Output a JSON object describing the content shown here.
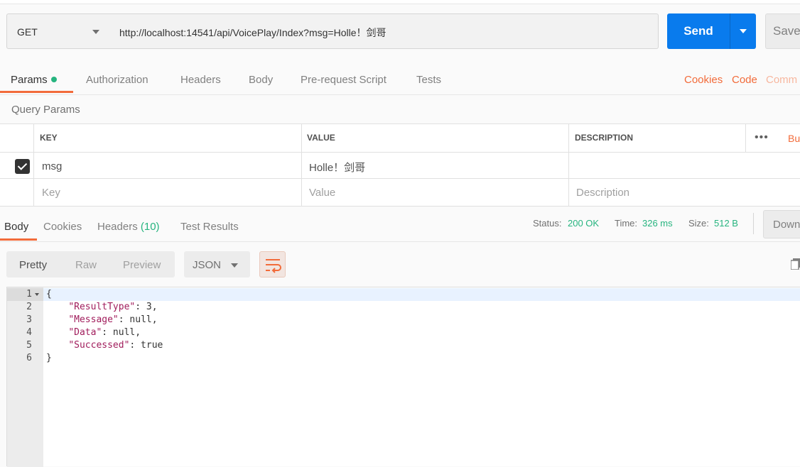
{
  "request": {
    "method": "GET",
    "url": "http://localhost:14541/api/VoicePlay/Index?msg=Holle！剑哥",
    "send_label": "Send",
    "save_label": "Save"
  },
  "request_tabs": {
    "params": "Params",
    "authorization": "Authorization",
    "headers": "Headers",
    "body": "Body",
    "pre_request": "Pre-request Script",
    "tests": "Tests",
    "cookies": "Cookies",
    "code": "Code",
    "comments": "Comm"
  },
  "query_params": {
    "title": "Query Params",
    "headers": {
      "key": "KEY",
      "value": "VALUE",
      "description": "DESCRIPTION",
      "bulk": "Bu"
    },
    "rows": [
      {
        "checked": true,
        "key": "msg",
        "value": "Holle！剑哥",
        "description": ""
      }
    ],
    "placeholders": {
      "key": "Key",
      "value": "Value",
      "description": "Description"
    }
  },
  "response_tabs": {
    "body": "Body",
    "cookies": "Cookies",
    "headers": "Headers",
    "headers_count": "(10)",
    "test_results": "Test Results"
  },
  "response_status": {
    "status_label": "Status:",
    "status_value": "200 OK",
    "time_label": "Time:",
    "time_value": "326 ms",
    "size_label": "Size:",
    "size_value": "512 B",
    "download": "Down"
  },
  "view": {
    "pretty": "Pretty",
    "raw": "Raw",
    "preview": "Preview",
    "format": "JSON"
  },
  "editor": {
    "line_numbers": [
      "1",
      "2",
      "3",
      "4",
      "5",
      "6"
    ],
    "lines": {
      "l1": "{",
      "l2_key": "\"ResultType\"",
      "l2_rest": ": 3,",
      "l3_key": "\"Message\"",
      "l3_rest": ": null,",
      "l4_key": "\"Data\"",
      "l4_rest": ": null,",
      "l5_key": "\"Successed\"",
      "l5_rest": ": true",
      "l6": "}"
    }
  },
  "colors": {
    "accent_orange": "#f26b3a",
    "send_blue": "#097bed",
    "status_green": "#26b47f",
    "json_key": "#a11d5c"
  },
  "icons": [
    "dropdown-caret-icon",
    "checkbox-checked-icon",
    "more-dots-icon",
    "wrap-lines-icon",
    "copy-icon",
    "fold-arrow-icon"
  ]
}
